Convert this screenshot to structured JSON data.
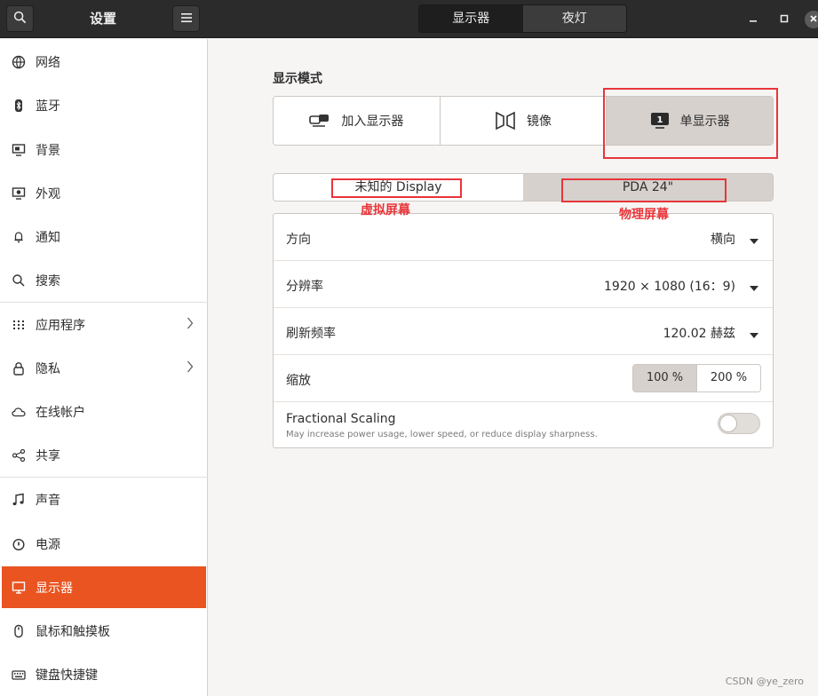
{
  "header": {
    "title": "设置",
    "tabs": [
      {
        "label": "显示器",
        "active": true
      },
      {
        "label": "夜灯",
        "active": false
      }
    ]
  },
  "sidebar": {
    "items": [
      {
        "label": "网络",
        "icon": "network-icon"
      },
      {
        "label": "蓝牙",
        "icon": "bluetooth-icon"
      },
      {
        "label": "背景",
        "icon": "background-icon"
      },
      {
        "label": "外观",
        "icon": "appearance-icon"
      },
      {
        "label": "通知",
        "icon": "bell-icon"
      },
      {
        "label": "搜索",
        "icon": "search-icon"
      },
      {
        "label": "应用程序",
        "icon": "apps-grid-icon"
      },
      {
        "label": "隐私",
        "icon": "lock-icon"
      },
      {
        "label": "在线帐户",
        "icon": "cloud-icon"
      },
      {
        "label": "共享",
        "icon": "share-icon"
      },
      {
        "label": "声音",
        "icon": "music-note-icon"
      },
      {
        "label": "电源",
        "icon": "power-icon"
      },
      {
        "label": "显示器",
        "icon": "display-icon",
        "active": true
      },
      {
        "label": "鼠标和触摸板",
        "icon": "mouse-icon"
      },
      {
        "label": "键盘快捷键",
        "icon": "keyboard-icon"
      }
    ]
  },
  "main": {
    "section_title": "显示模式",
    "modes": [
      {
        "label": "加入显示器",
        "icon": "join-displays-icon",
        "selected": false
      },
      {
        "label": "镜像",
        "icon": "mirror-icon",
        "selected": false
      },
      {
        "label": "单显示器",
        "icon": "single-display-icon",
        "badge": "1",
        "selected": true
      }
    ],
    "display_tabs": [
      {
        "label": "未知的 Display",
        "active": true
      },
      {
        "label": "PDA 24\"",
        "active": false
      }
    ],
    "orientation": {
      "label": "方向",
      "value": "横向"
    },
    "resolution": {
      "label": "分辨率",
      "value": "1920 × 1080 (16：9)"
    },
    "refresh": {
      "label": "刷新频率",
      "value": "120.02 赫兹"
    },
    "scale": {
      "label": "缩放",
      "options": [
        "100 %",
        "200 %"
      ],
      "selected": "100 %"
    },
    "fractional": {
      "title": "Fractional Scaling",
      "subtitle": "May increase power usage, lower speed, or reduce display sharpness.",
      "enabled": false
    }
  },
  "annotations": {
    "virtual": "虚拟屏幕",
    "physical": "物理屏幕"
  },
  "watermark": "CSDN @ye_zero",
  "colors": {
    "accent": "#e95420",
    "annotation": "#e8353a",
    "header_bg": "#2b2b2b"
  }
}
